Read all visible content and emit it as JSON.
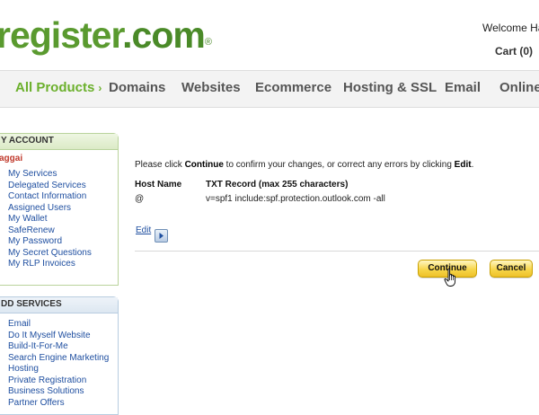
{
  "header": {
    "logo_part1": "register",
    "logo_part2": ".com",
    "logo_mark": "®",
    "welcome_text": "Welcome Ha",
    "cart_text": "Cart (0)"
  },
  "nav": {
    "items": [
      {
        "label": "All Products",
        "suffix": "›"
      },
      {
        "label": "Domains"
      },
      {
        "label": "Websites"
      },
      {
        "label": "Ecommerce"
      },
      {
        "label": "Hosting & SSL"
      },
      {
        "label": "Email"
      },
      {
        "label": "Online"
      }
    ]
  },
  "sidebar": {
    "account": {
      "title": "Y ACCOUNT",
      "user": "aggai",
      "links": [
        "My Services",
        "Delegated Services",
        "Contact Information",
        "Assigned Users",
        "My Wallet",
        "SafeRenew",
        "My Password",
        "My Secret Questions",
        "My RLP Invoices"
      ]
    },
    "services": {
      "title": "DD SERVICES",
      "links": [
        "Email",
        "Do It Myself Website",
        "Build-It-For-Me",
        "Search Engine Marketing",
        "Hosting",
        "Private Registration",
        "Business Solutions",
        "Partner Offers"
      ]
    }
  },
  "main": {
    "intro_pre": "Please click ",
    "intro_continue": "Continue",
    "intro_mid": " to confirm your changes, or correct any errors by clicking ",
    "intro_edit": "Edit",
    "intro_end": ".",
    "columns": [
      "Host Name",
      "TXT Record (max 255 characters)"
    ],
    "row": [
      "@",
      "v=spf1 include:spf.protection.outlook.com -all"
    ],
    "edit_label": "Edit",
    "continue_label": "Continue",
    "cancel_label": "Cancel"
  },
  "icons": {
    "edit_arrow": "arrow-right-icon",
    "cursor": "hand-pointer-icon"
  },
  "colors": {
    "brand_green": "#5a9a2f",
    "nav_active": "#6bb02c",
    "link_blue": "#1f4fa0",
    "button_yellow": "#f7d64b"
  }
}
